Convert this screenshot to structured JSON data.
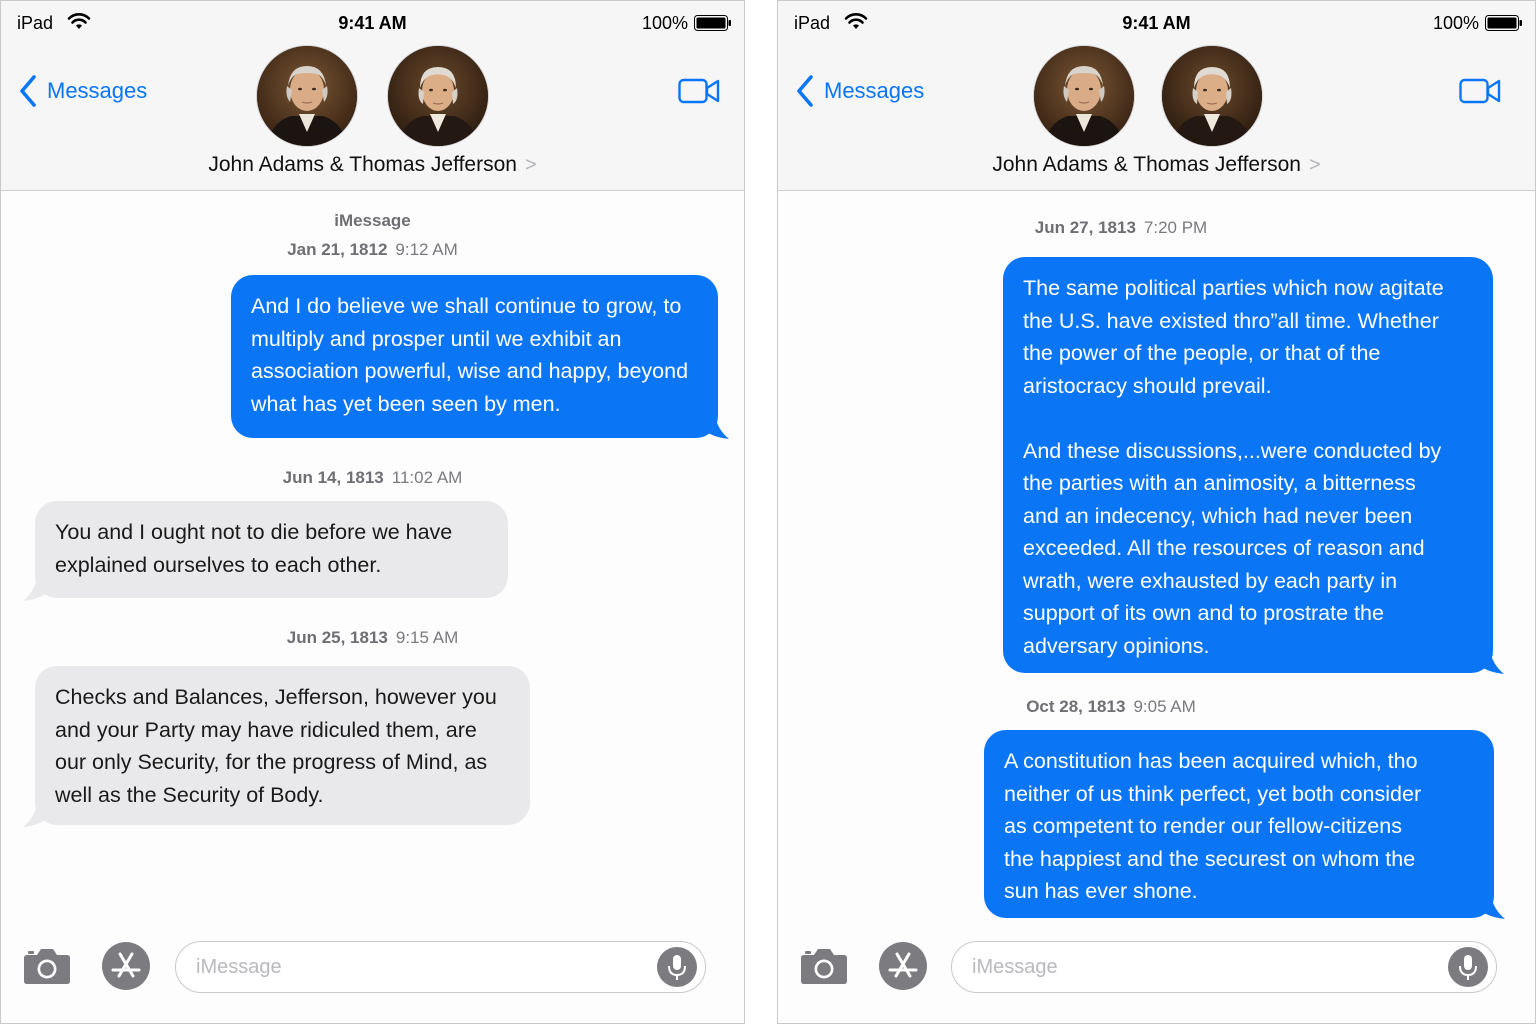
{
  "status_bar": {
    "device": "iPad",
    "time": "9:41 AM",
    "battery": "100%"
  },
  "header": {
    "back_label": "Messages",
    "contact_name": "John Adams & Thomas Jefferson",
    "chevron": ">"
  },
  "left_screen": {
    "service_label": "iMessage",
    "messages": [
      {
        "date": "Jan 21, 1812",
        "time": "9:12 AM",
        "type": "sent",
        "lines": [
          "And I do believe we shall continue to grow, to",
          "multiply and prosper until we exhibit an",
          "association powerful, wise and happy, beyond",
          "what has yet been seen by men."
        ]
      },
      {
        "date": "Jun 14, 1813",
        "time": "11:02 AM",
        "type": "received",
        "lines": [
          "You and I ought not to die before we have",
          "explained ourselves to each other."
        ]
      },
      {
        "date": "Jun 25, 1813",
        "time": "9:15 AM",
        "type": "received",
        "lines": [
          "Checks and Balances, Jefferson, however you",
          "and your Party may have ridiculed them, are",
          "our only Security, for the progress of Mind, as",
          "well as the Security of Body."
        ]
      }
    ]
  },
  "right_screen": {
    "messages": [
      {
        "date": "Jun 27, 1813",
        "time": "7:20 PM",
        "type": "sent",
        "lines": [
          "The same political parties which now agitate",
          "the U.S. have existed thro”all time. Whether",
          "the power of the people, or that of the",
          "aristocracy should prevail.",
          "",
          "And these discussions,...were conducted by",
          "the parties with an animosity, a bitterness",
          "and an indecency, which had never been",
          "exceeded. All the resources of reason and",
          "wrath, were exhausted by each party in",
          "support of its own and to prostrate the",
          "adversary opinions."
        ]
      },
      {
        "date": "Oct 28, 1813",
        "time": "9:05 AM",
        "type": "sent",
        "lines": [
          "A constitution has been acquired which, tho",
          "neither of us think perfect, yet both consider",
          "as competent to render our fellow-citizens",
          "the happiest and the securest on whom the",
          "sun has ever shone."
        ]
      }
    ]
  },
  "composer": {
    "placeholder": "iMessage"
  },
  "colors": {
    "accent": "#0a76f5",
    "sent_bubble": "#0a76f5",
    "received_bubble": "#e9e9eb",
    "header_bg": "#f6f6f7"
  },
  "icons": [
    "back-chevron-icon",
    "wifi-icon",
    "battery-icon",
    "video-camera-icon",
    "camera-icon",
    "app-store-icon",
    "microphone-icon",
    "chevron-right-icon"
  ]
}
